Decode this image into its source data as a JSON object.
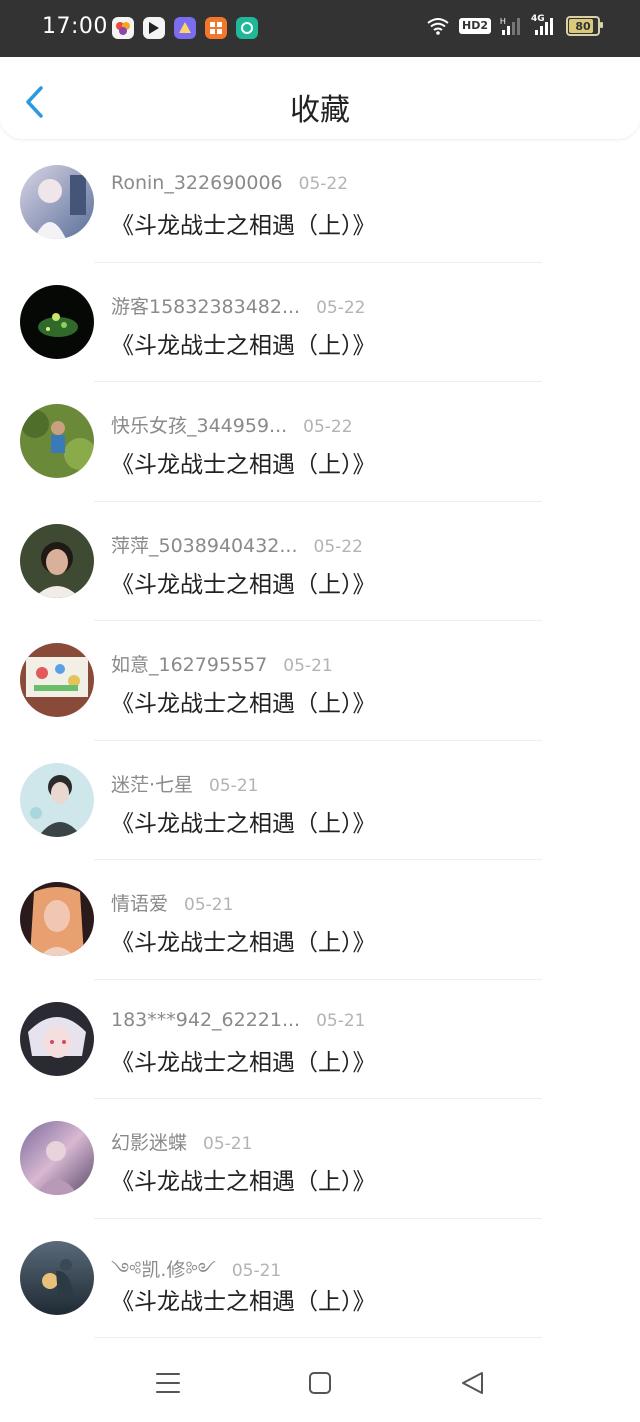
{
  "status": {
    "time": "17:00",
    "hd_label": "HD2",
    "network": "4G",
    "battery": "80",
    "battery_level": 0.8,
    "app_icons": [
      "app-icon-1",
      "app-icon-2",
      "app-icon-3",
      "app-icon-4",
      "app-icon-5"
    ]
  },
  "header": {
    "back_icon": "chevron-left-icon",
    "title": "收藏"
  },
  "items": [
    {
      "user": "Ronin_322690006",
      "date": "05-22",
      "work": "《斗龙战士之相遇（上）》"
    },
    {
      "user": "游客15832383482...",
      "date": "05-22",
      "work": "《斗龙战士之相遇（上）》"
    },
    {
      "user": "快乐女孩_344959...",
      "date": "05-22",
      "work": "《斗龙战士之相遇（上）》"
    },
    {
      "user": "萍萍_5038940432...",
      "date": "05-22",
      "work": "《斗龙战士之相遇（上）》"
    },
    {
      "user": "如意_162795557",
      "date": "05-21",
      "work": "《斗龙战士之相遇（上）》"
    },
    {
      "user": "迷茫·七星",
      "date": "05-21",
      "work": "《斗龙战士之相遇（上）》"
    },
    {
      "user": "情语爱",
      "date": "05-21",
      "work": "《斗龙战士之相遇（上）》"
    },
    {
      "user": "183***942_62221...",
      "date": "05-21",
      "work": "《斗龙战士之相遇（上）》"
    },
    {
      "user": "幻影迷蝶",
      "date": "05-21",
      "work": "《斗龙战士之相遇（上）》"
    },
    {
      "user": "༺凯.修༻",
      "date": "05-21",
      "work": "《斗龙战士之相遇（上）》"
    }
  ],
  "navbar": [
    "menu-icon",
    "home-square-icon",
    "back-triangle-icon"
  ],
  "colors": {
    "accent": "#2a9ae0",
    "status_bar": "#333333",
    "username": "#8a8a8a",
    "date": "#b3b3b3"
  }
}
